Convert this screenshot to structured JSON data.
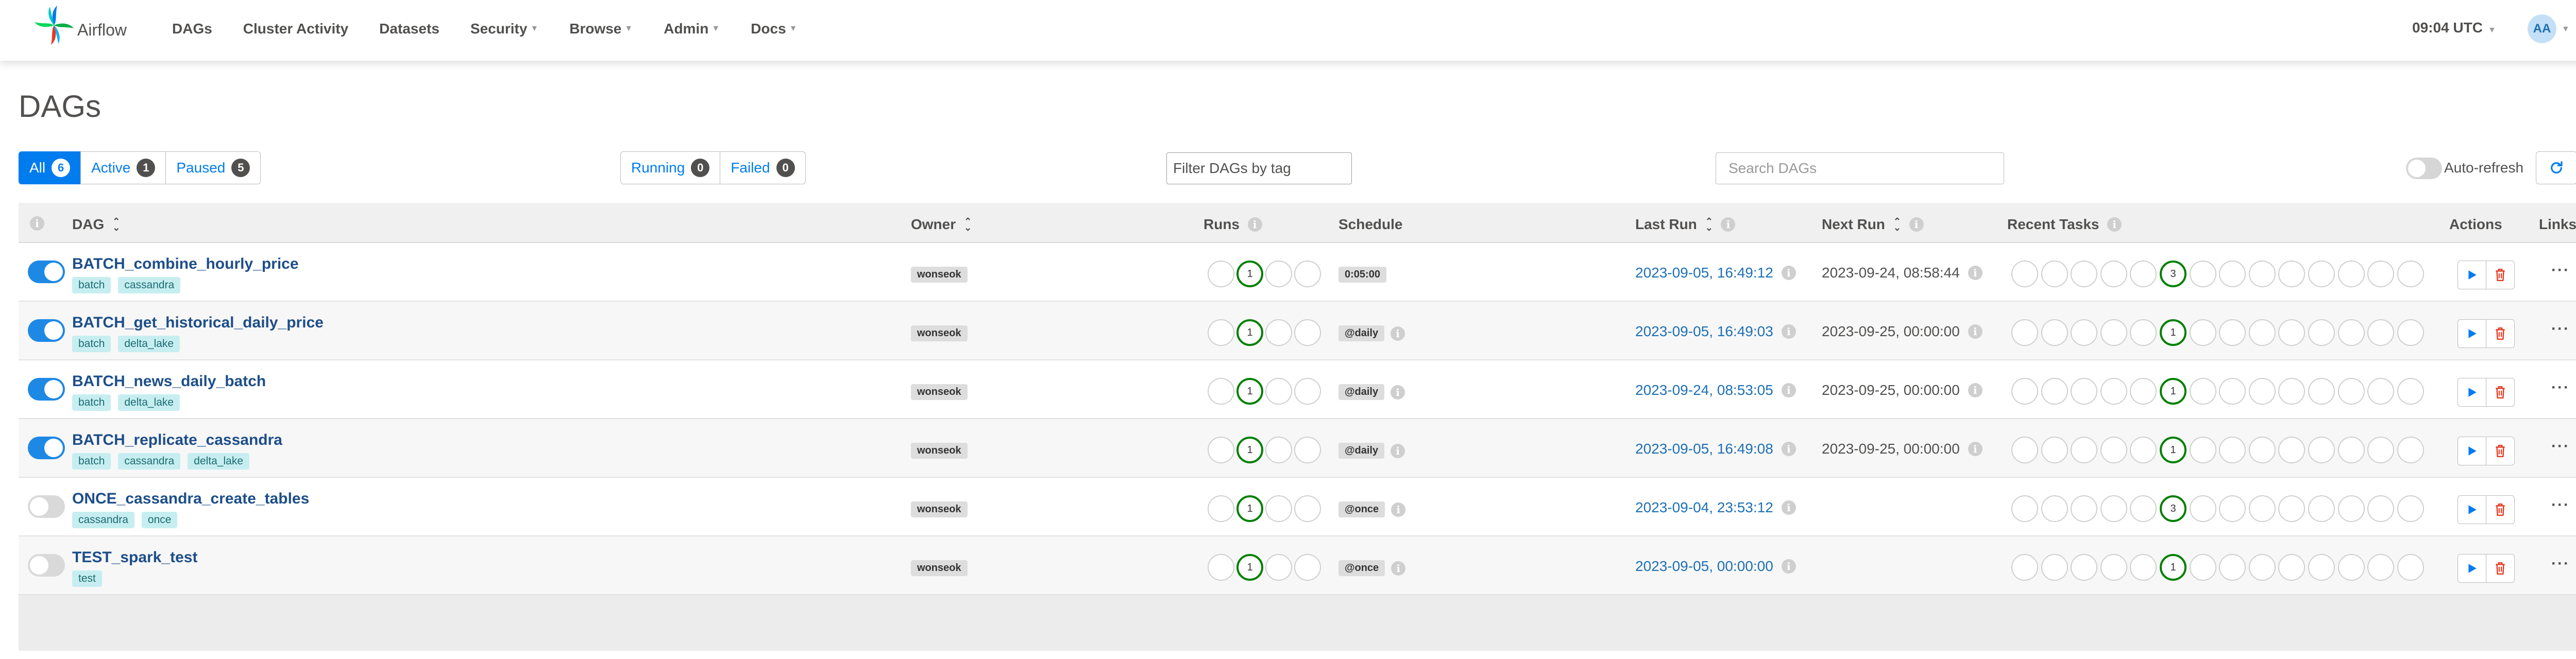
{
  "nav": {
    "brand": "Airflow",
    "menu": [
      {
        "label": "DAGs",
        "dropdown": false
      },
      {
        "label": "Cluster Activity",
        "dropdown": false
      },
      {
        "label": "Datasets",
        "dropdown": false
      },
      {
        "label": "Security",
        "dropdown": true
      },
      {
        "label": "Browse",
        "dropdown": true
      },
      {
        "label": "Admin",
        "dropdown": true
      },
      {
        "label": "Docs",
        "dropdown": true
      }
    ],
    "time": "09:04 UTC",
    "user_initials": "AA"
  },
  "page": {
    "title": "DAGs"
  },
  "filters": {
    "status": [
      {
        "label": "All",
        "count": "6",
        "active": true
      },
      {
        "label": "Active",
        "count": "1",
        "active": false
      },
      {
        "label": "Paused",
        "count": "5",
        "active": false
      }
    ],
    "runs": [
      {
        "label": "Running",
        "count": "0"
      },
      {
        "label": "Failed",
        "count": "0"
      }
    ],
    "tag_filter_placeholder": "Filter DAGs by tag",
    "search_placeholder": "Search DAGs",
    "auto_refresh_label": "Auto-refresh",
    "auto_refresh_on": false
  },
  "table": {
    "headers": {
      "dag": "DAG",
      "owner": "Owner",
      "runs": "Runs",
      "schedule": "Schedule",
      "last_run": "Last Run",
      "next_run": "Next Run",
      "recent_tasks": "Recent Tasks",
      "actions": "Actions",
      "links": "Links"
    },
    "rows": [
      {
        "dag_id": "BATCH_combine_hourly_price",
        "paused": false,
        "tags": [
          "batch",
          "cassandra"
        ],
        "owner": "wonseok",
        "runs_success": "1",
        "runs_success_index": 1,
        "schedule": "0:05:00",
        "schedule_info": false,
        "last_run": "2023-09-05, 16:49:12",
        "next_run": "2023-09-24, 08:58:44",
        "recent_tasks_success": "3",
        "recent_tasks_success_index": 5
      },
      {
        "dag_id": "BATCH_get_historical_daily_price",
        "paused": false,
        "tags": [
          "batch",
          "delta_lake"
        ],
        "owner": "wonseok",
        "runs_success": "1",
        "runs_success_index": 1,
        "schedule": "@daily",
        "schedule_info": true,
        "last_run": "2023-09-05, 16:49:03",
        "next_run": "2023-09-25, 00:00:00",
        "recent_tasks_success": "1",
        "recent_tasks_success_index": 5
      },
      {
        "dag_id": "BATCH_news_daily_batch",
        "paused": false,
        "tags": [
          "batch",
          "delta_lake"
        ],
        "owner": "wonseok",
        "runs_success": "1",
        "runs_success_index": 1,
        "schedule": "@daily",
        "schedule_info": true,
        "last_run": "2023-09-24, 08:53:05",
        "next_run": "2023-09-25, 00:00:00",
        "recent_tasks_success": "1",
        "recent_tasks_success_index": 5
      },
      {
        "dag_id": "BATCH_replicate_cassandra",
        "paused": false,
        "tags": [
          "batch",
          "cassandra",
          "delta_lake"
        ],
        "owner": "wonseok",
        "runs_success": "1",
        "runs_success_index": 1,
        "schedule": "@daily",
        "schedule_info": true,
        "last_run": "2023-09-05, 16:49:08",
        "next_run": "2023-09-25, 00:00:00",
        "recent_tasks_success": "1",
        "recent_tasks_success_index": 5
      },
      {
        "dag_id": "ONCE_cassandra_create_tables",
        "paused": true,
        "tags": [
          "cassandra",
          "once"
        ],
        "owner": "wonseok",
        "runs_success": "1",
        "runs_success_index": 1,
        "schedule": "@once",
        "schedule_info": true,
        "last_run": "2023-09-04, 23:53:12",
        "next_run": "",
        "recent_tasks_success": "3",
        "recent_tasks_success_index": 5
      },
      {
        "dag_id": "TEST_spark_test",
        "paused": true,
        "tags": [
          "test"
        ],
        "owner": "wonseok",
        "runs_success": "1",
        "runs_success_index": 1,
        "schedule": "@once",
        "schedule_info": true,
        "last_run": "2023-09-05, 00:00:00",
        "next_run": "",
        "recent_tasks_success": "1",
        "recent_tasks_success_index": 5
      }
    ]
  },
  "colors": {
    "primary": "#017cee",
    "success": "#008000",
    "danger": "#e43921",
    "dag_link": "#1d4e89",
    "tag_bg": "#c6eef0"
  },
  "icons": {
    "info": "info-icon",
    "sort": "sort-icon",
    "trigger": "play-icon",
    "delete": "trash-icon",
    "links": "more-icon",
    "refresh": "refresh-icon"
  }
}
